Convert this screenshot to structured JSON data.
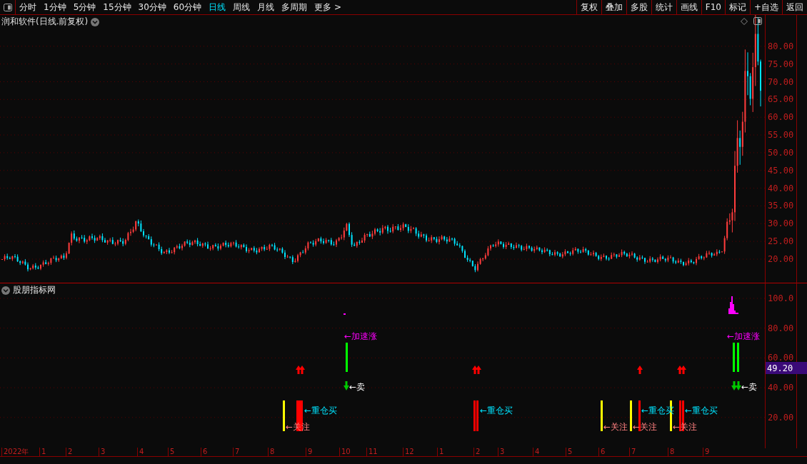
{
  "toolbar": {
    "periods": [
      {
        "label": "分时",
        "selected": false
      },
      {
        "label": "1分钟",
        "selected": false
      },
      {
        "label": "5分钟",
        "selected": false
      },
      {
        "label": "15分钟",
        "selected": false
      },
      {
        "label": "30分钟",
        "selected": false
      },
      {
        "label": "60分钟",
        "selected": false
      },
      {
        "label": "日线",
        "selected": true
      },
      {
        "label": "周线",
        "selected": false
      },
      {
        "label": "月线",
        "selected": false
      },
      {
        "label": "多周期",
        "selected": false
      },
      {
        "label": "更多 >",
        "selected": false
      }
    ],
    "actions": [
      "复权",
      "叠加",
      "多股",
      "统计",
      "画线",
      "F10",
      "标记",
      "+自选",
      "返回"
    ]
  },
  "price_pane": {
    "title": "润和软件(日线.前复权)",
    "axis": [
      "80.00",
      "75.00",
      "70.00",
      "65.00",
      "60.00",
      "55.00",
      "50.00",
      "45.00",
      "40.00",
      "35.00",
      "30.00",
      "25.00",
      "20.00"
    ]
  },
  "indicator_pane": {
    "title": "股朋指标网",
    "axis": [
      "100.0",
      "80.00",
      "60.00",
      "40.00",
      "20.00"
    ],
    "current_value": "49.20",
    "signals": [
      {
        "kind": "accelerate",
        "label": "←加速涨"
      },
      {
        "kind": "accelerate",
        "label": "←加速涨"
      },
      {
        "kind": "sell",
        "label": "←卖"
      },
      {
        "kind": "sell",
        "label": "←卖"
      },
      {
        "kind": "heavy_buy",
        "label": "←重仓买"
      },
      {
        "kind": "heavy_buy",
        "label": "←重仓买"
      },
      {
        "kind": "heavy_buy",
        "label": "←重仓买"
      },
      {
        "kind": "heavy_buy",
        "label": "←重仓买"
      },
      {
        "kind": "watch",
        "label": "←关注"
      },
      {
        "kind": "watch",
        "label": "←关注"
      },
      {
        "kind": "watch",
        "label": "←关注"
      },
      {
        "kind": "watch",
        "label": "←关注"
      }
    ]
  },
  "time_axis": [
    "2022年",
    "1",
    "2",
    "3",
    "4",
    "5",
    "6",
    "7",
    "8",
    "9",
    "10",
    "11",
    "12",
    "1",
    "2",
    "3",
    "4",
    "5",
    "6",
    "7",
    "8",
    "9"
  ]
}
